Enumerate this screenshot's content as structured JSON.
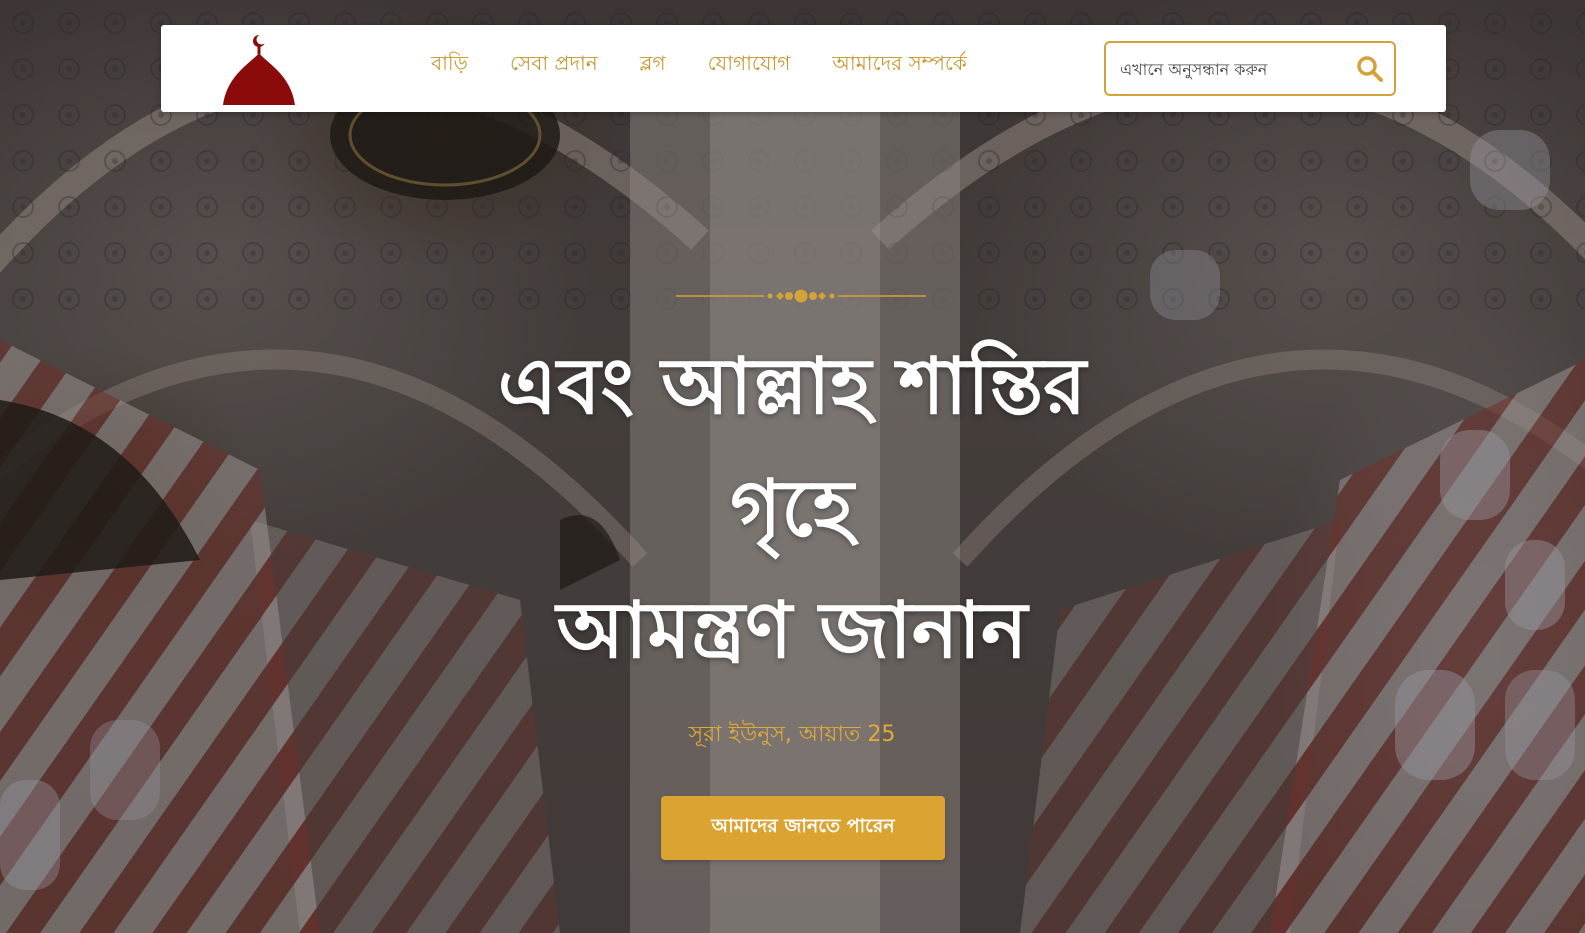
{
  "nav": {
    "links": [
      "বাড়ি",
      "সেবা প্রদান",
      "ব্লগ",
      "যোগাযোগ",
      "আমাদের সম্পর্কে"
    ]
  },
  "search": {
    "placeholder": "এখানে অনুসন্ধান করুন",
    "icon": "search-icon"
  },
  "logo": {
    "icon": "mosque-dome-icon",
    "color": "#8b0a0a"
  },
  "hero": {
    "headline_line1": "এবং আল্লাহ শান্তির",
    "headline_line2": "গৃহে",
    "headline_line3": "আমন্ত্রণ জানান",
    "reference": "সূরা ইউনুস, আয়াত 25",
    "cta_label": "আমাদের জানতে পারেন"
  },
  "colors": {
    "accent": "#dba332",
    "nav_text": "#c8962a",
    "headline": "#ffffff"
  }
}
